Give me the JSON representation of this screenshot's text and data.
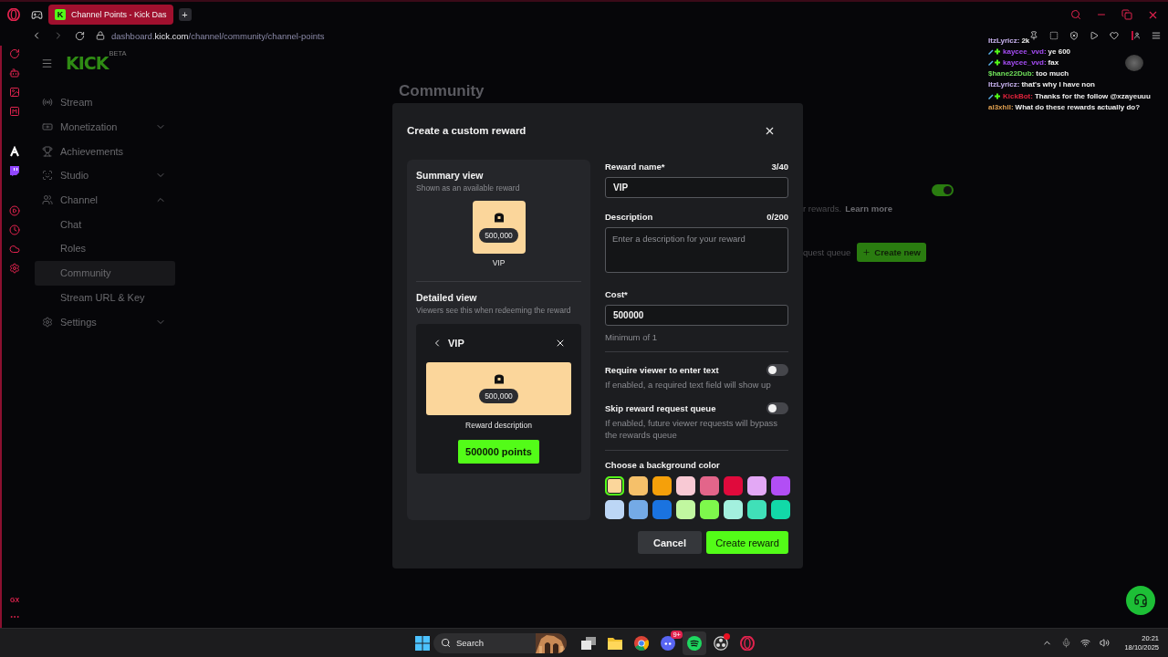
{
  "browser": {
    "tab": {
      "favicon": "K",
      "title": "Channel Points - Kick Das",
      "selected": true
    },
    "new_tab": "+",
    "url": {
      "subdomain": "dashboard.",
      "domain": "kick.com",
      "path": "/channel/community/channel-points"
    }
  },
  "opera_sidebar": {
    "bottom_label": "GX"
  },
  "kick": {
    "logo": "KICK",
    "logo_badge": "BETA",
    "nav": [
      {
        "label": "Stream",
        "kind": "stream"
      },
      {
        "label": "Monetization",
        "kind": "money",
        "expanded": false
      },
      {
        "label": "Achievements",
        "kind": "trophy"
      },
      {
        "label": "Studio",
        "kind": "studio",
        "expanded": false
      },
      {
        "label": "Channel",
        "kind": "people",
        "expanded": true,
        "children": [
          {
            "label": "Chat",
            "selected": false
          },
          {
            "label": "Roles",
            "selected": false
          },
          {
            "label": "Community",
            "selected": true
          },
          {
            "label": "Stream URL & Key",
            "selected": false
          }
        ]
      },
      {
        "label": "Settings",
        "kind": "gear",
        "expanded": false
      }
    ]
  },
  "page": {
    "title": "Community",
    "toggle": {
      "on": true
    },
    "hint_fragment": "r rewards.",
    "learn_more": "Learn more",
    "queue_button": "quest queue",
    "create_button": "Create new"
  },
  "modal": {
    "title": "Create a custom reward",
    "summary": {
      "title": "Summary view",
      "subtitle": "Shown as an available reward",
      "cost": "500,000",
      "name": "VIP"
    },
    "detail": {
      "title": "Detailed view",
      "subtitle": "Viewers see this when redeeming the reward",
      "name": "VIP",
      "cost": "500,000",
      "description": "Reward description",
      "points_button": "500000 points"
    },
    "fields": [
      {
        "kind": "input",
        "label": "Reward name*",
        "counter": "3/40",
        "value": "VIP"
      },
      {
        "kind": "textarea",
        "label": "Description",
        "counter": "0/200",
        "placeholder": "Enter a description for your reward"
      },
      {
        "kind": "input",
        "label": "Cost*",
        "value": "500000",
        "hint": "Minimum of 1"
      }
    ],
    "toggles": [
      {
        "label": "Require viewer to enter text",
        "description": "If enabled, a required text field will show up",
        "on": false
      },
      {
        "label": "Skip reward request queue",
        "description": "If enabled, future viewer requests will bypass the rewards queue",
        "on": false
      }
    ],
    "color_label": "Choose a background color",
    "colors": [
      {
        "color": "#fbd69b",
        "selected": true
      },
      {
        "color": "#f5c06a",
        "selected": false
      },
      {
        "color": "#f5a00a",
        "selected": false
      },
      {
        "color": "#f8c9d4",
        "selected": false
      },
      {
        "color": "#e3658a",
        "selected": false
      },
      {
        "color": "#e00a3c",
        "selected": false
      },
      {
        "color": "#e3a8f5",
        "selected": false
      },
      {
        "color": "#b24ef5",
        "selected": false
      },
      {
        "color": "#bcd6f5",
        "selected": false
      },
      {
        "color": "#74aae6",
        "selected": false
      },
      {
        "color": "#1a73e0",
        "selected": false
      },
      {
        "color": "#c1f7a0",
        "selected": false
      },
      {
        "color": "#7ef84c",
        "selected": false
      },
      {
        "color": "#a3f0de",
        "selected": false
      },
      {
        "color": "#40e0b8",
        "selected": false
      },
      {
        "color": "#12d9a8",
        "selected": false
      }
    ],
    "cancel": "Cancel",
    "submit": "Create reward"
  },
  "chat": [
    {
      "user": "ItzLyricz:",
      "message": "2k",
      "color": "#c9b3f0",
      "badged": false
    },
    {
      "user": "kaycee_vvd:",
      "message": "ye 600",
      "color": "#a64df5",
      "badged": true
    },
    {
      "user": "kaycee_vvd:",
      "message": "fax",
      "color": "#a64df5",
      "badged": true
    },
    {
      "user": "$hane22Dub:",
      "message": "too much",
      "color": "#6fe05a",
      "badged": false
    },
    {
      "user": "ItzLyricz:",
      "message": "that's why I have non",
      "color": "#c9b3f0",
      "badged": false
    },
    {
      "user": "KickBot:",
      "message": "Thanks for the follow @xzayeuuu",
      "color": "#e0233c",
      "badged": true
    },
    {
      "user": "al3xhll:",
      "message": "What do these rewards actually do?",
      "color": "#e0a050",
      "badged": false
    }
  ],
  "taskbar": {
    "search_label": "Search",
    "apps": [
      {
        "kind": "taskview",
        "selected": false
      },
      {
        "kind": "folder",
        "selected": false
      },
      {
        "kind": "chrome",
        "selected": false
      },
      {
        "kind": "discord",
        "selected": false,
        "badge": "9+"
      },
      {
        "kind": "spotify",
        "selected": true
      },
      {
        "kind": "obs",
        "selected": false,
        "alert": true
      },
      {
        "kind": "opera",
        "selected": false
      }
    ],
    "time": "20:21",
    "date": "18/10/2025"
  }
}
